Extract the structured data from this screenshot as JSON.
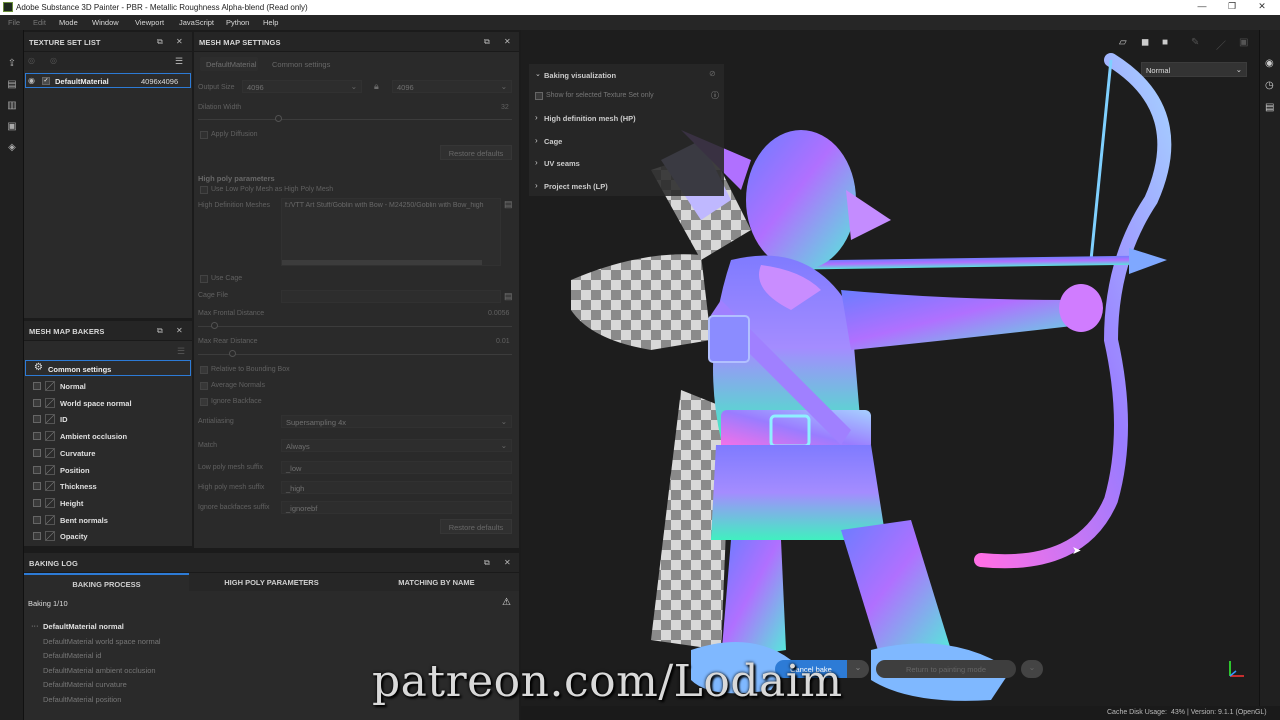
{
  "titlebar": {
    "title": "Adobe Substance 3D Painter - PBR - Metallic Roughness Alpha-blend (Read only)",
    "minimize": "—",
    "maximize": "❐",
    "close": "✕"
  },
  "menu": [
    "File",
    "Edit",
    "Mode",
    "Window",
    "Viewport",
    "JavaScript",
    "Python",
    "Help"
  ],
  "texture_set_list": {
    "title": "TEXTURE SET LIST",
    "item_name": "DefaultMaterial",
    "item_size": "4096x4096"
  },
  "mesh_map_settings": {
    "title": "MESH MAP SETTINGS",
    "tab_material": "DefaultMaterial",
    "tab_common": "Common settings",
    "output_size_label": "Output Size",
    "output_size_a": "4096",
    "output_size_b": "4096",
    "dilation_label": "Dilation Width",
    "dilation_value": "32",
    "apply_diffusion": "Apply Diffusion",
    "restore_defaults": "Restore defaults",
    "high_poly_heading": "High poly parameters",
    "use_low_poly": "Use Low Poly Mesh as High Poly Mesh",
    "hd_meshes_label": "High Definition Meshes",
    "hd_meshes_value": "f:/VTT Art Stuff/Goblin with Bow - M24250/Goblin with Bow_high",
    "use_cage": "Use Cage",
    "cage_file": "Cage File",
    "max_frontal_label": "Max Frontal Distance",
    "max_frontal_value": "0.0056",
    "max_rear_label": "Max Rear Distance",
    "max_rear_value": "0.01",
    "relative_bbox": "Relative to Bounding Box",
    "average_normals": "Average Normals",
    "ignore_backface": "Ignore Backface",
    "antialiasing_label": "Antialiasing",
    "antialiasing_value": "Supersampling 4x",
    "match_label": "Match",
    "match_value": "Always",
    "low_suffix_label": "Low poly mesh suffix",
    "low_suffix_value": "_low",
    "high_suffix_label": "High poly mesh suffix",
    "high_suffix_value": "_high",
    "ignore_suffix_label": "Ignore backfaces suffix",
    "ignore_suffix_value": "_ignorebf",
    "restore_defaults_2": "Restore defaults"
  },
  "mesh_map_bakers": {
    "title": "MESH MAP BAKERS",
    "common_settings": "Common settings",
    "items": [
      "Normal",
      "World space normal",
      "ID",
      "Ambient occlusion",
      "Curvature",
      "Position",
      "Thickness",
      "Height",
      "Bent normals",
      "Opacity"
    ]
  },
  "baking_log": {
    "title": "BAKING LOG",
    "tabs": [
      "BAKING PROCESS",
      "HIGH POLY PARAMETERS",
      "MATCHING BY NAME"
    ],
    "progress": "Baking 1/10",
    "current": "DefaultMaterial normal",
    "lines": [
      "DefaultMaterial world space normal",
      "DefaultMaterial id",
      "DefaultMaterial ambient occlusion",
      "DefaultMaterial curvature",
      "DefaultMaterial position"
    ]
  },
  "viewport": {
    "display_mode": "Normal",
    "baking_visualization": "Baking visualization",
    "show_selected": "Show for selected Texture Set only",
    "sections": [
      "High definition mesh (HP)",
      "Cage",
      "UV seams",
      "Project mesh (LP)"
    ],
    "cancel_bake": "Cancel bake",
    "return_painting": "Return to painting mode"
  },
  "watermark": "patreon.com/Lodaim",
  "status": {
    "cache": "Cache Disk Usage:",
    "cache_value": "43%",
    "version": "| Version: 9.1.1 (OpenGL)"
  },
  "colors": {
    "accent": "#2d7bd6",
    "panel": "#2a2a2a",
    "selected": "#2d7bd6"
  }
}
